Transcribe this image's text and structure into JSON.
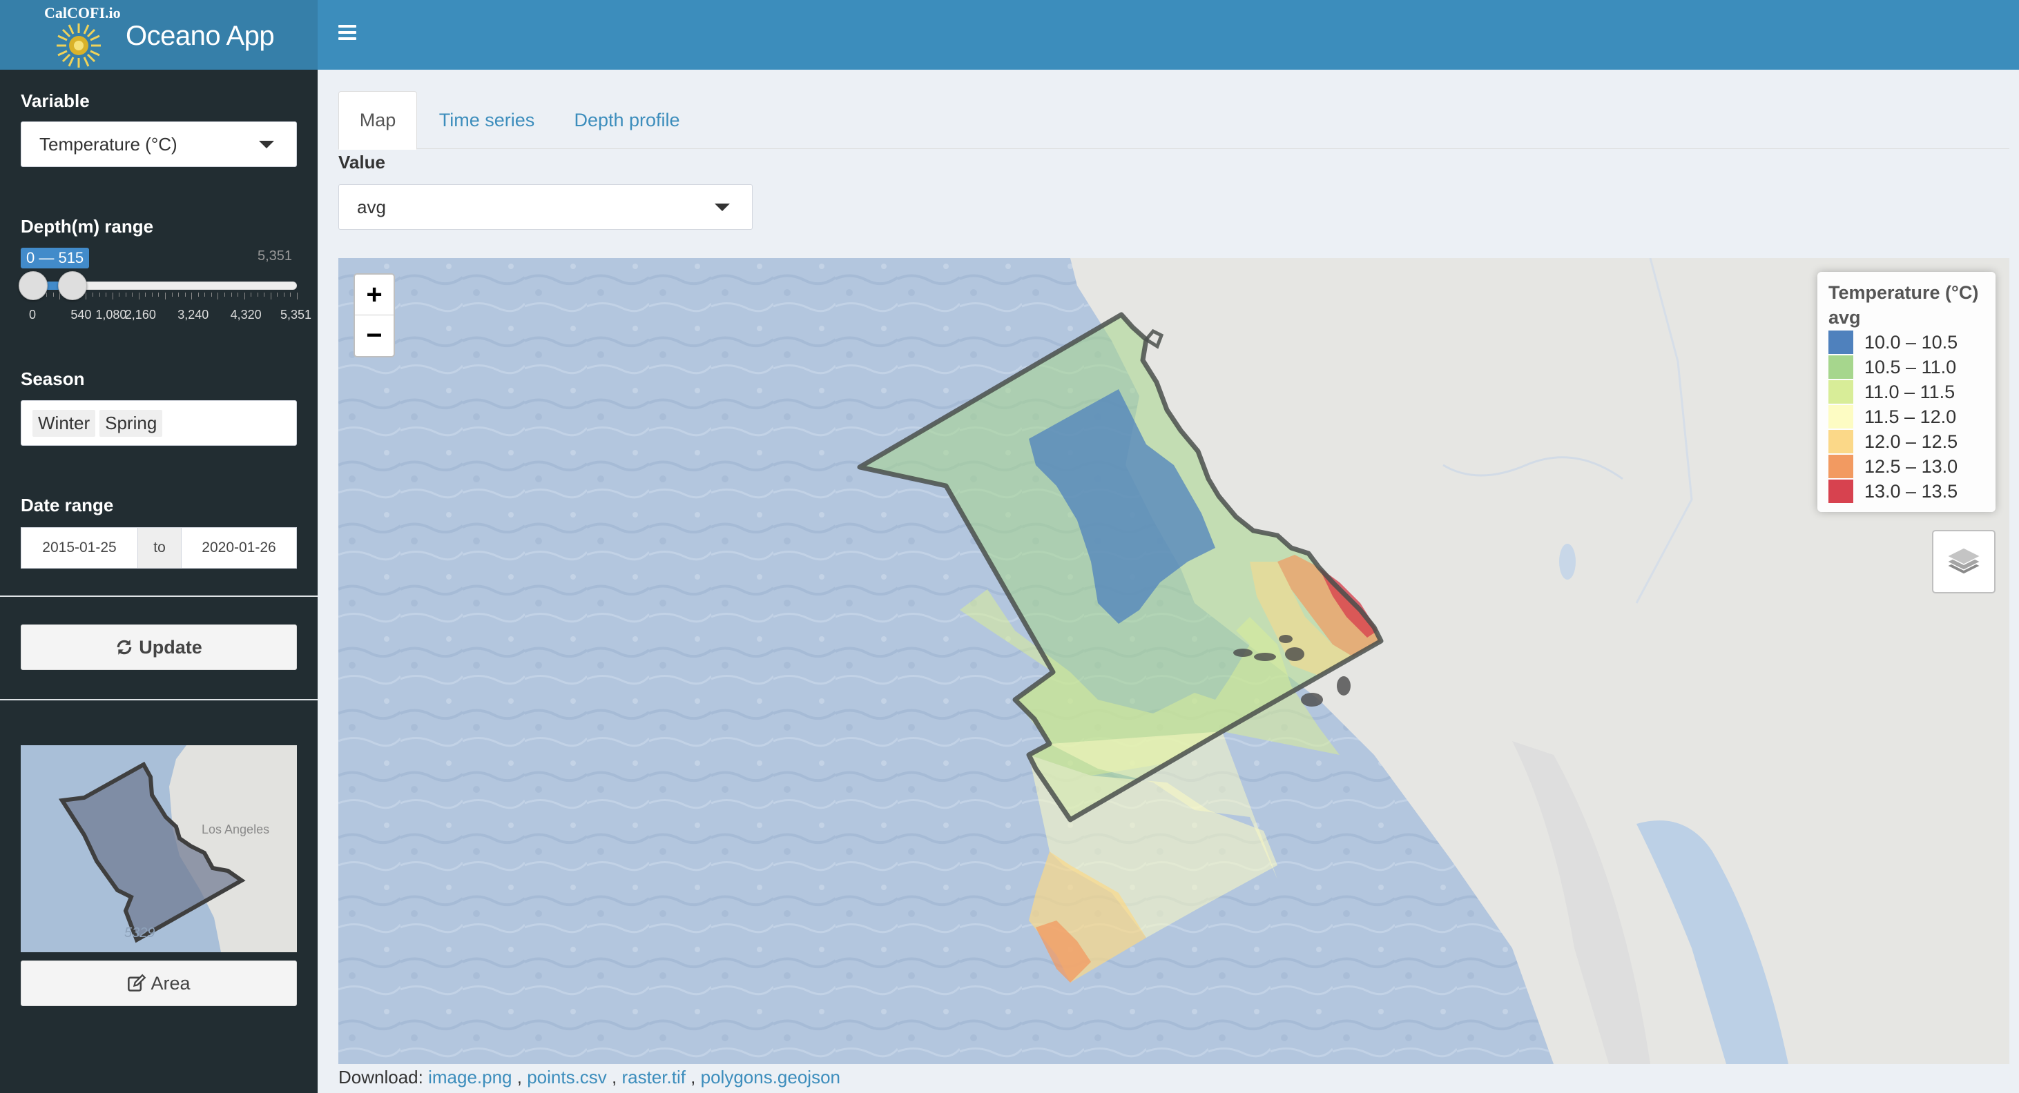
{
  "header": {
    "brand": "CalCOFI.io",
    "title": "Oceano App"
  },
  "sidebar": {
    "variable": {
      "label": "Variable",
      "value": "Temperature (°C)"
    },
    "depth": {
      "label": "Depth(m) range",
      "selected": "0 — 515",
      "max_label": "5,351",
      "range_min": 0,
      "range_max": 5351,
      "value_low": 0,
      "value_high": 515,
      "ticks": [
        "0",
        "540",
        "1,080",
        "2,160",
        "3,240",
        "4,320",
        "5,351"
      ]
    },
    "season": {
      "label": "Season",
      "chips": [
        "Winter",
        "Spring"
      ]
    },
    "date_range": {
      "label": "Date range",
      "start": "2015-01-25",
      "sep": "to",
      "end": "2020-01-26"
    },
    "update_label": "Update",
    "area_label": "Area",
    "minimap": {
      "city": "Los Angeles",
      "number": "5329"
    }
  },
  "main": {
    "tabs": [
      "Map",
      "Time series",
      "Depth profile"
    ],
    "active_tab": "Map",
    "value_label": "Value",
    "value_selected": "avg"
  },
  "map": {
    "zoom_in": "+",
    "zoom_out": "−",
    "legend": {
      "title": "Temperature (°C)",
      "subtitle": "avg",
      "items": [
        {
          "label": "10.0 – 10.5",
          "color": "#4f81bd"
        },
        {
          "label": "10.5 – 11.0",
          "color": "#a6d68d"
        },
        {
          "label": "11.0 – 11.5",
          "color": "#d8ed98"
        },
        {
          "label": "11.5 – 12.0",
          "color": "#fdfcc3"
        },
        {
          "label": "12.0 – 12.5",
          "color": "#fbd888"
        },
        {
          "label": "12.5 – 13.0",
          "color": "#f29a61"
        },
        {
          "label": "13.0 – 13.5",
          "color": "#d7424f"
        }
      ]
    }
  },
  "download": {
    "label": "Download:",
    "links": [
      "image.png",
      "points.csv",
      "raster.tif",
      "polygons.geojson"
    ]
  },
  "colors": {
    "header": "#3c8dbc",
    "header_logo": "#367fa9",
    "sidebar": "#222d32",
    "link": "#3c8dbc"
  }
}
